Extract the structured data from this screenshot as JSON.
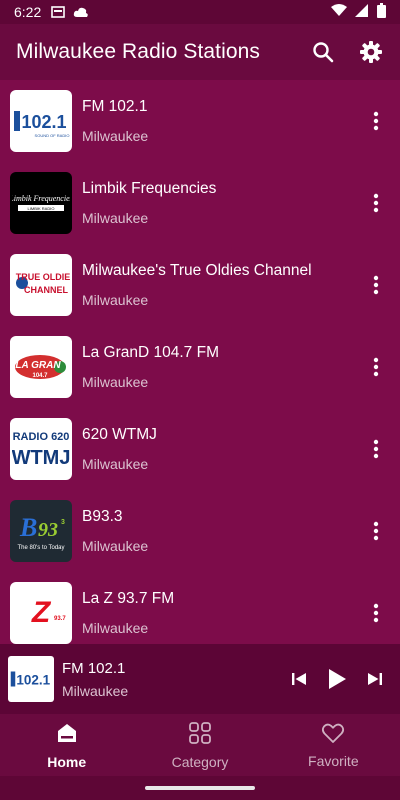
{
  "status_bar": {
    "time": "6:22",
    "icons": [
      "sim-card-icon",
      "cloud-icon",
      "wifi-icon",
      "signal-icon",
      "battery-icon"
    ]
  },
  "app_bar": {
    "title": "Milwaukee Radio Stations",
    "actions": [
      "search-icon",
      "settings-icon"
    ]
  },
  "stations": [
    {
      "name": "FM 102.1",
      "city": "Milwaukee",
      "logo_text": "102.1",
      "logo_colors": [
        "#ffffff",
        "#1b4f9c"
      ]
    },
    {
      "name": "Limbik Frequencies",
      "city": "Milwaukee",
      "logo_text": "Limbik Frequencies",
      "logo_colors": [
        "#000000",
        "#ffffff"
      ]
    },
    {
      "name": "Milwaukee's True Oldies Channel",
      "city": "Milwaukee",
      "logo_text": "TRUE OLDIES CHANNEL",
      "logo_colors": [
        "#ffffff",
        "#c8102e"
      ]
    },
    {
      "name": "La GranD 104.7 FM",
      "city": "Milwaukee",
      "logo_text": "LA GRAN",
      "logo_colors": [
        "#ffffff",
        "#d32f2f"
      ]
    },
    {
      "name": "620 WTMJ",
      "city": "Milwaukee",
      "logo_text": "WTMJ",
      "logo_colors": [
        "#ffffff",
        "#123a7a"
      ]
    },
    {
      "name": "B93.3",
      "city": "Milwaukee",
      "logo_text": "B93.3",
      "logo_colors": [
        "#1f2a33",
        "#9acd32"
      ]
    },
    {
      "name": "La Z 93.7 FM",
      "city": "Milwaukee",
      "logo_text": "Z",
      "logo_colors": [
        "#ffffff",
        "#e3101f"
      ]
    }
  ],
  "player": {
    "name": "FM 102.1",
    "city": "Milwaukee",
    "logo_text": "102.1"
  },
  "bottom_nav": [
    {
      "label": "Home",
      "icon": "home-icon",
      "active": true
    },
    {
      "label": "Category",
      "icon": "category-icon",
      "active": false
    },
    {
      "label": "Favorite",
      "icon": "heart-icon",
      "active": false
    }
  ],
  "colors": {
    "background": "#7d0c4a",
    "app_bar": "#6a0a3f",
    "player": "#5c0536"
  }
}
